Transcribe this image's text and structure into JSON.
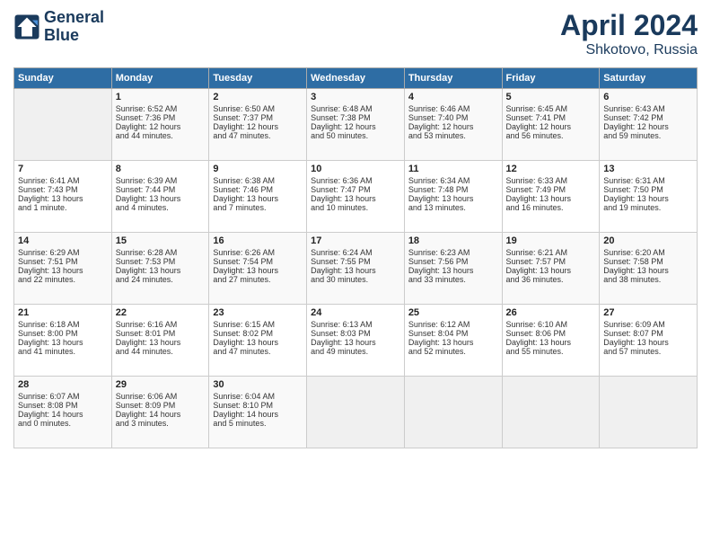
{
  "header": {
    "logo_line1": "General",
    "logo_line2": "Blue",
    "month": "April 2024",
    "location": "Shkotovo, Russia"
  },
  "days_of_week": [
    "Sunday",
    "Monday",
    "Tuesday",
    "Wednesday",
    "Thursday",
    "Friday",
    "Saturday"
  ],
  "weeks": [
    [
      {
        "day": "",
        "data": ""
      },
      {
        "day": "1",
        "data": "Sunrise: 6:52 AM\nSunset: 7:36 PM\nDaylight: 12 hours\nand 44 minutes."
      },
      {
        "day": "2",
        "data": "Sunrise: 6:50 AM\nSunset: 7:37 PM\nDaylight: 12 hours\nand 47 minutes."
      },
      {
        "day": "3",
        "data": "Sunrise: 6:48 AM\nSunset: 7:38 PM\nDaylight: 12 hours\nand 50 minutes."
      },
      {
        "day": "4",
        "data": "Sunrise: 6:46 AM\nSunset: 7:40 PM\nDaylight: 12 hours\nand 53 minutes."
      },
      {
        "day": "5",
        "data": "Sunrise: 6:45 AM\nSunset: 7:41 PM\nDaylight: 12 hours\nand 56 minutes."
      },
      {
        "day": "6",
        "data": "Sunrise: 6:43 AM\nSunset: 7:42 PM\nDaylight: 12 hours\nand 59 minutes."
      }
    ],
    [
      {
        "day": "7",
        "data": "Sunrise: 6:41 AM\nSunset: 7:43 PM\nDaylight: 13 hours\nand 1 minute."
      },
      {
        "day": "8",
        "data": "Sunrise: 6:39 AM\nSunset: 7:44 PM\nDaylight: 13 hours\nand 4 minutes."
      },
      {
        "day": "9",
        "data": "Sunrise: 6:38 AM\nSunset: 7:46 PM\nDaylight: 13 hours\nand 7 minutes."
      },
      {
        "day": "10",
        "data": "Sunrise: 6:36 AM\nSunset: 7:47 PM\nDaylight: 13 hours\nand 10 minutes."
      },
      {
        "day": "11",
        "data": "Sunrise: 6:34 AM\nSunset: 7:48 PM\nDaylight: 13 hours\nand 13 minutes."
      },
      {
        "day": "12",
        "data": "Sunrise: 6:33 AM\nSunset: 7:49 PM\nDaylight: 13 hours\nand 16 minutes."
      },
      {
        "day": "13",
        "data": "Sunrise: 6:31 AM\nSunset: 7:50 PM\nDaylight: 13 hours\nand 19 minutes."
      }
    ],
    [
      {
        "day": "14",
        "data": "Sunrise: 6:29 AM\nSunset: 7:51 PM\nDaylight: 13 hours\nand 22 minutes."
      },
      {
        "day": "15",
        "data": "Sunrise: 6:28 AM\nSunset: 7:53 PM\nDaylight: 13 hours\nand 24 minutes."
      },
      {
        "day": "16",
        "data": "Sunrise: 6:26 AM\nSunset: 7:54 PM\nDaylight: 13 hours\nand 27 minutes."
      },
      {
        "day": "17",
        "data": "Sunrise: 6:24 AM\nSunset: 7:55 PM\nDaylight: 13 hours\nand 30 minutes."
      },
      {
        "day": "18",
        "data": "Sunrise: 6:23 AM\nSunset: 7:56 PM\nDaylight: 13 hours\nand 33 minutes."
      },
      {
        "day": "19",
        "data": "Sunrise: 6:21 AM\nSunset: 7:57 PM\nDaylight: 13 hours\nand 36 minutes."
      },
      {
        "day": "20",
        "data": "Sunrise: 6:20 AM\nSunset: 7:58 PM\nDaylight: 13 hours\nand 38 minutes."
      }
    ],
    [
      {
        "day": "21",
        "data": "Sunrise: 6:18 AM\nSunset: 8:00 PM\nDaylight: 13 hours\nand 41 minutes."
      },
      {
        "day": "22",
        "data": "Sunrise: 6:16 AM\nSunset: 8:01 PM\nDaylight: 13 hours\nand 44 minutes."
      },
      {
        "day": "23",
        "data": "Sunrise: 6:15 AM\nSunset: 8:02 PM\nDaylight: 13 hours\nand 47 minutes."
      },
      {
        "day": "24",
        "data": "Sunrise: 6:13 AM\nSunset: 8:03 PM\nDaylight: 13 hours\nand 49 minutes."
      },
      {
        "day": "25",
        "data": "Sunrise: 6:12 AM\nSunset: 8:04 PM\nDaylight: 13 hours\nand 52 minutes."
      },
      {
        "day": "26",
        "data": "Sunrise: 6:10 AM\nSunset: 8:06 PM\nDaylight: 13 hours\nand 55 minutes."
      },
      {
        "day": "27",
        "data": "Sunrise: 6:09 AM\nSunset: 8:07 PM\nDaylight: 13 hours\nand 57 minutes."
      }
    ],
    [
      {
        "day": "28",
        "data": "Sunrise: 6:07 AM\nSunset: 8:08 PM\nDaylight: 14 hours\nand 0 minutes."
      },
      {
        "day": "29",
        "data": "Sunrise: 6:06 AM\nSunset: 8:09 PM\nDaylight: 14 hours\nand 3 minutes."
      },
      {
        "day": "30",
        "data": "Sunrise: 6:04 AM\nSunset: 8:10 PM\nDaylight: 14 hours\nand 5 minutes."
      },
      {
        "day": "",
        "data": ""
      },
      {
        "day": "",
        "data": ""
      },
      {
        "day": "",
        "data": ""
      },
      {
        "day": "",
        "data": ""
      }
    ]
  ]
}
